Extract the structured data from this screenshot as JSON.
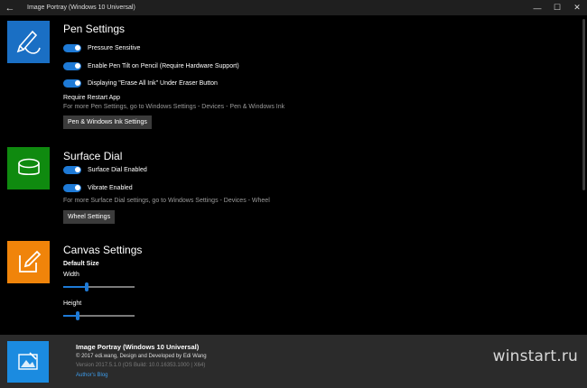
{
  "window": {
    "title": "Image Portray (Windows 10 Universal)",
    "back_icon": "←",
    "min_icon": "—",
    "max_icon": "☐",
    "close_icon": "✕"
  },
  "colors": {
    "pen_icon_bg": "#1a6fc4",
    "dial_icon_bg": "#0f8a0f",
    "canvas_icon_bg": "#f0840a",
    "accent": "#1e7ad6"
  },
  "pen": {
    "title": "Pen Settings",
    "toggles": [
      {
        "label": "Pressure Sensitive",
        "on": true
      },
      {
        "label": "Enable Pen Tilt on Pencil (Require Hardware Support)",
        "on": true
      },
      {
        "label": "Displaying \"Erase All Ink\" Under Eraser Button",
        "on": true
      }
    ],
    "restart_note": "Require Restart App",
    "more_info": "For more Pen Settings, go to Windows Settings - Devices - Pen & Windows Ink",
    "button": "Pen & Windows Ink Settings"
  },
  "dial": {
    "title": "Surface Dial",
    "toggles": [
      {
        "label": "Surface Dial Enabled",
        "on": true
      },
      {
        "label": "Vibrate Enabled",
        "on": true
      }
    ],
    "more_info": "For more Surface Dial settings, go to Windows Settings - Devices - Wheel",
    "button": "Wheel Settings"
  },
  "canvas": {
    "title": "Canvas Settings",
    "default_size": "Default Size",
    "width_label": "Width",
    "height_label": "Height",
    "width_value_fraction": 0.33,
    "height_value_fraction": 0.2
  },
  "footer": {
    "app_title": "Image Portray (Windows 10 Universal)",
    "copyright": "© 2017 edi.wang, Design and Developed by Edi Wang",
    "version": "Version 2017.5.1.0 (OS Build: 10.0.16353.1000 | X64)",
    "link": "Author's Blog"
  },
  "watermark": "winstart.ru"
}
